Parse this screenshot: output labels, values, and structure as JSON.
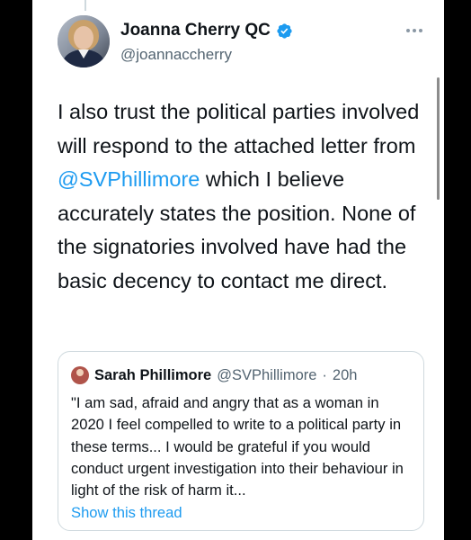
{
  "tweet": {
    "author_name": "Joanna Cherry QC",
    "author_handle": "@joannaccherry",
    "text_before": "I also trust the political parties involved will respond to the attached letter from ",
    "mention": "@SVPhillimore",
    "text_after": " which I believe accurately states the position. None of the signatories involved have had the basic decency to contact me direct."
  },
  "quoted": {
    "author_name": "Sarah Phillimore",
    "author_handle": "@SVPhillimore",
    "separator": "·",
    "time": "20h",
    "text": "\"I am sad, afraid and angry that as a woman in 2020 I feel compelled to write to a political party in these terms... I would be grateful if you would conduct urgent investigation into their behaviour in light of the risk of harm it...",
    "show_thread": "Show this thread"
  },
  "colors": {
    "link": "#1d9bf0",
    "text": "#0f1419",
    "secondary": "#536471",
    "border": "#cfd9de"
  }
}
